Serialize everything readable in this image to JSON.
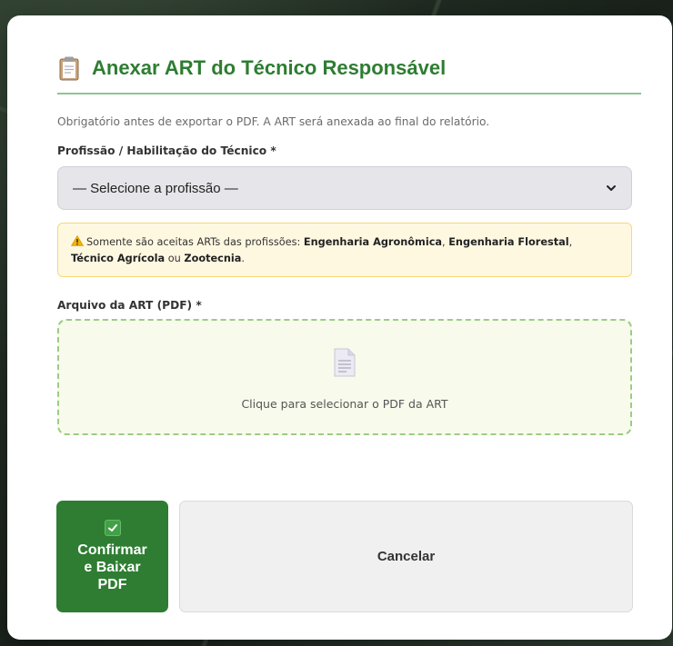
{
  "dialog": {
    "title": "Anexar ART do Técnico Responsável",
    "subtitle": "Obrigatório antes de exportar o PDF. A ART será anexada ao final do relatório."
  },
  "profession": {
    "label": "Profissão / Habilitação do Técnico *",
    "selected": "— Selecione a profissão —"
  },
  "warning": {
    "prefix": "Somente são aceitas ARTs das profissões: ",
    "p1": "Engenharia Agronômica",
    "sep1": ", ",
    "p2": "Engenharia Florestal",
    "sep2": ", ",
    "p3": "Técnico Agrícola",
    "sep3": " ou ",
    "p4": "Zootecnia",
    "suffix": "."
  },
  "file": {
    "label": "Arquivo da ART (PDF) *",
    "dropzone_text": "Clique para selecionar o PDF da ART"
  },
  "actions": {
    "confirm_label": "Confirmar\ne Baixar\nPDF",
    "cancel_label": "Cancelar"
  },
  "colors": {
    "accent": "#2e7d32",
    "warning_bg": "#fff8e1",
    "dropzone_border": "#9ccc85"
  },
  "icons": {
    "title": "clipboard-icon",
    "warning": "warning-triangle-icon",
    "dropzone": "document-icon",
    "confirm": "checkbox-check-icon",
    "select": "chevron-down-icon"
  }
}
